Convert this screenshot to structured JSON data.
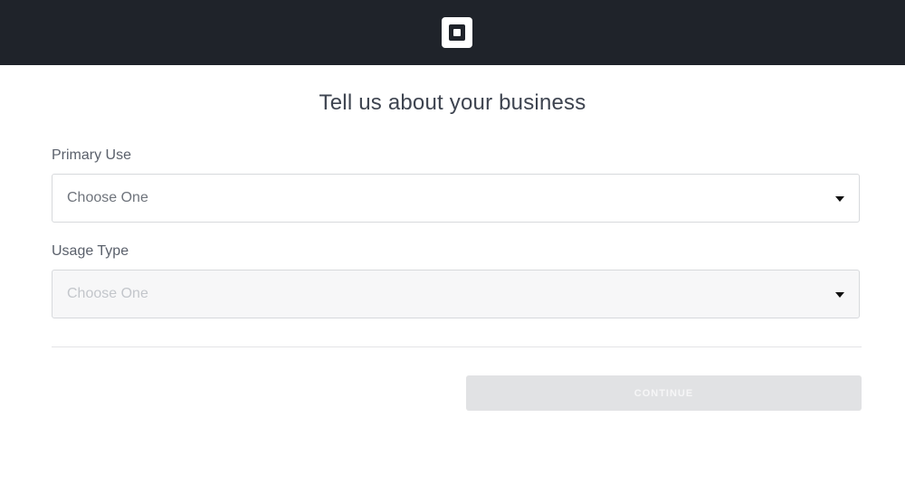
{
  "header": {
    "logo_icon": "square-logo-icon",
    "background_color": "#1f232a"
  },
  "page": {
    "title": "Tell us about your business"
  },
  "form": {
    "primary_use": {
      "label": "Primary Use",
      "value": "Choose One"
    },
    "usage_type": {
      "label": "Usage Type",
      "value": "Choose One",
      "disabled": true
    },
    "continue_label": "CONTINUE"
  }
}
